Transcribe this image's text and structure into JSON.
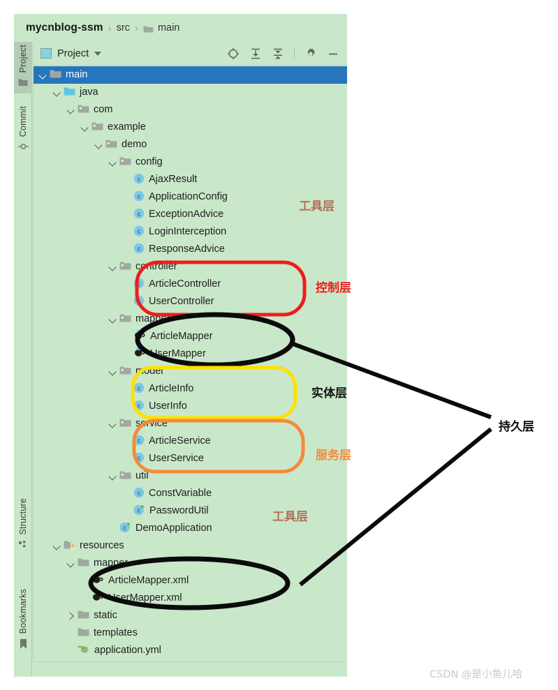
{
  "window": {
    "breadcrumb": {
      "project": "mycnblog-ssm",
      "separator": "›",
      "items": [
        {
          "label": "src",
          "icon": "none"
        },
        {
          "label": "main",
          "icon": "folder-icon"
        }
      ]
    }
  },
  "tool_stripe": {
    "top_buttons": [
      {
        "label": "Project",
        "icon": "folder-icon",
        "active": true
      },
      {
        "label": "Commit",
        "icon": "commit-icon",
        "active": false
      }
    ],
    "bottom_buttons": [
      {
        "label": "Structure",
        "icon": "structure-icon",
        "active": false
      },
      {
        "label": "Bookmarks",
        "icon": "bookmark-icon",
        "active": false
      }
    ]
  },
  "panel": {
    "title": "Project",
    "dropdown_icon": "chevron-down-icon",
    "toolbar_icons": [
      {
        "name": "locate-target-icon",
        "title": "Select Opened File"
      },
      {
        "name": "expand-all-icon",
        "title": "Expand All"
      },
      {
        "name": "collapse-all-icon",
        "title": "Collapse All"
      },
      {
        "name": "gear-icon",
        "title": "Options"
      },
      {
        "name": "minimize-icon",
        "title": "Hide"
      }
    ]
  },
  "tree": [
    {
      "label": "main",
      "indent": 1,
      "chevron": "open",
      "icon": "folder-icon",
      "selected": true
    },
    {
      "label": "java",
      "indent": 2,
      "chevron": "open",
      "icon": "source-root-icon",
      "selected": false
    },
    {
      "label": "com",
      "indent": 3,
      "chevron": "open",
      "icon": "package-icon",
      "selected": false
    },
    {
      "label": "example",
      "indent": 4,
      "chevron": "open",
      "icon": "package-icon",
      "selected": false
    },
    {
      "label": "demo",
      "indent": 5,
      "chevron": "open",
      "icon": "package-icon",
      "selected": false
    },
    {
      "label": "config",
      "indent": 6,
      "chevron": "open",
      "icon": "package-icon",
      "selected": false
    },
    {
      "label": "AjaxResult",
      "indent": 7,
      "chevron": "none",
      "icon": "class-icon",
      "selected": false
    },
    {
      "label": "ApplicationConfig",
      "indent": 7,
      "chevron": "none",
      "icon": "class-icon",
      "selected": false
    },
    {
      "label": "ExceptionAdvice",
      "indent": 7,
      "chevron": "none",
      "icon": "class-icon",
      "selected": false
    },
    {
      "label": "LoginInterception",
      "indent": 7,
      "chevron": "none",
      "icon": "class-icon",
      "selected": false
    },
    {
      "label": "ResponseAdvice",
      "indent": 7,
      "chevron": "none",
      "icon": "class-icon",
      "selected": false
    },
    {
      "label": "controller",
      "indent": 6,
      "chevron": "open",
      "icon": "package-icon",
      "selected": false
    },
    {
      "label": "ArticleController",
      "indent": 7,
      "chevron": "none",
      "icon": "class-icon",
      "selected": false
    },
    {
      "label": "UserController",
      "indent": 7,
      "chevron": "none",
      "icon": "class-icon",
      "selected": false
    },
    {
      "label": "mapper",
      "indent": 6,
      "chevron": "open",
      "icon": "package-icon",
      "selected": false
    },
    {
      "label": "ArticleMapper",
      "indent": 7,
      "chevron": "none",
      "icon": "mybatis-mapper-icon",
      "selected": false
    },
    {
      "label": "UserMapper",
      "indent": 7,
      "chevron": "none",
      "icon": "mybatis-mapper-icon",
      "selected": false
    },
    {
      "label": "model",
      "indent": 6,
      "chevron": "open",
      "icon": "package-icon",
      "selected": false
    },
    {
      "label": "ArticleInfo",
      "indent": 7,
      "chevron": "none",
      "icon": "class-icon",
      "selected": false
    },
    {
      "label": "UserInfo",
      "indent": 7,
      "chevron": "none",
      "icon": "class-icon",
      "selected": false
    },
    {
      "label": "service",
      "indent": 6,
      "chevron": "open",
      "icon": "package-icon",
      "selected": false
    },
    {
      "label": "ArticleService",
      "indent": 7,
      "chevron": "none",
      "icon": "class-icon",
      "selected": false
    },
    {
      "label": "UserService",
      "indent": 7,
      "chevron": "none",
      "icon": "class-icon",
      "selected": false
    },
    {
      "label": "util",
      "indent": 6,
      "chevron": "open",
      "icon": "package-icon",
      "selected": false
    },
    {
      "label": "ConstVariable",
      "indent": 7,
      "chevron": "none",
      "icon": "class-icon",
      "selected": false
    },
    {
      "label": "PasswordUtil",
      "indent": 7,
      "chevron": "none",
      "icon": "runnable-class-icon",
      "selected": false
    },
    {
      "label": "DemoApplication",
      "indent": 6,
      "chevron": "none",
      "icon": "runnable-class-icon",
      "selected": false
    },
    {
      "label": "resources",
      "indent": 2,
      "chevron": "open",
      "icon": "resource-root-icon",
      "selected": false
    },
    {
      "label": "mapper",
      "indent": 3,
      "chevron": "open",
      "icon": "folder-icon",
      "selected": false
    },
    {
      "label": "ArticleMapper.xml",
      "indent": 4,
      "chevron": "none",
      "icon": "mybatis-xml-icon",
      "selected": false
    },
    {
      "label": "UserMapper.xml",
      "indent": 4,
      "chevron": "none",
      "icon": "mybatis-xml-icon",
      "selected": false
    },
    {
      "label": "static",
      "indent": 3,
      "chevron": "closed",
      "icon": "folder-icon",
      "selected": false
    },
    {
      "label": "templates",
      "indent": 3,
      "chevron": "none",
      "icon": "folder-icon",
      "selected": false
    },
    {
      "label": "application.yml",
      "indent": 3,
      "chevron": "none",
      "icon": "yaml-file-icon",
      "selected": false
    }
  ],
  "annotations": {
    "tool_layer_top": "工具层",
    "control_layer": "控制层",
    "entity_layer": "实体层",
    "service_layer": "服务层",
    "tool_layer_bottom": "工具层",
    "persistence_layer": "持久层"
  },
  "annotation_colors": {
    "tool_layer": "#b5705a",
    "control_layer": "#f01c1c",
    "entity_layer": "#141414",
    "service_layer": "#f58a3c",
    "persistence_layer": "#0c0c0c",
    "model_highlight": "#ffe000",
    "selection_blue": "#2675bd",
    "panel_green": "#c9e8ca"
  },
  "watermark": "CSDN @是小鱼儿哈"
}
